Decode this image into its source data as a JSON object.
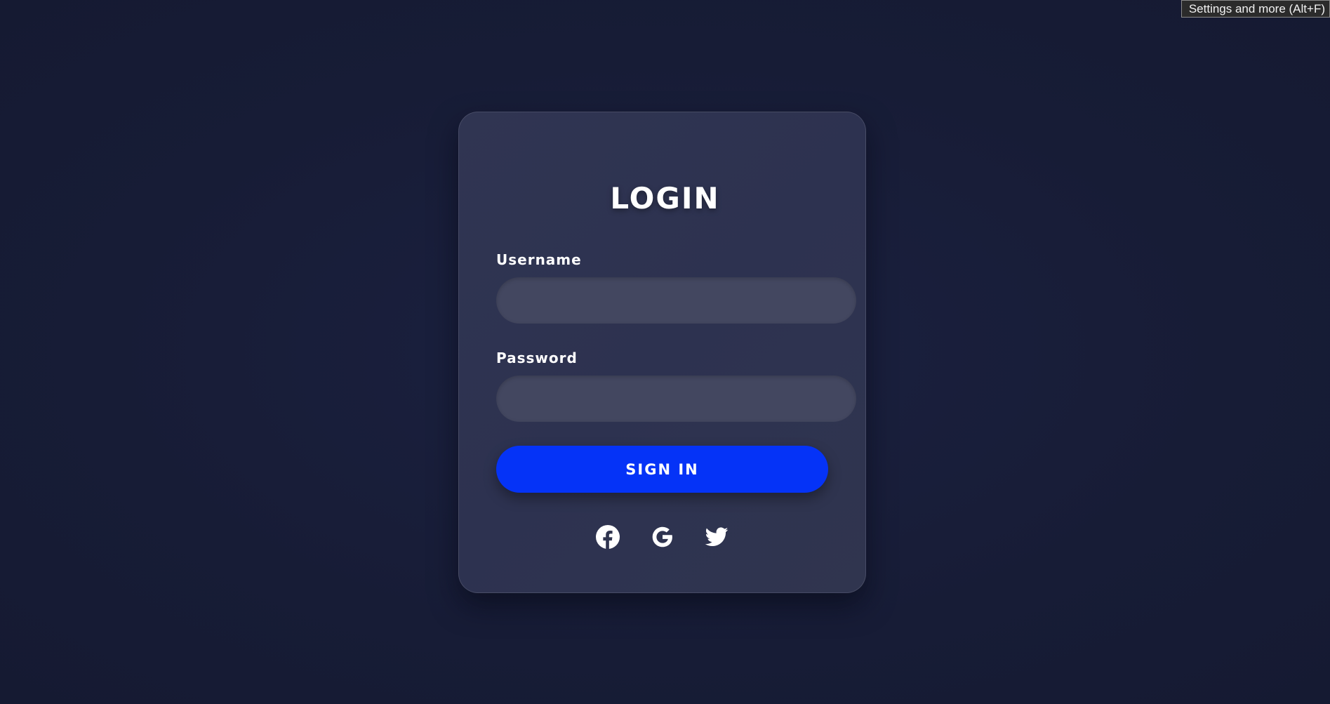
{
  "tooltip": {
    "text": "Settings and more (Alt+F)"
  },
  "login": {
    "title": "LOGIN",
    "username_label": "Username",
    "username_value": "",
    "password_label": "Password",
    "password_value": "",
    "submit_label": "SIGN IN"
  },
  "social": [
    {
      "icon": "facebook-icon"
    },
    {
      "icon": "google-icon"
    },
    {
      "icon": "twitter-icon"
    }
  ],
  "colors": {
    "background": "#171c36",
    "card": "#2f344f",
    "field": "#434760",
    "accent": "#0533f7",
    "text": "#ffffff"
  }
}
